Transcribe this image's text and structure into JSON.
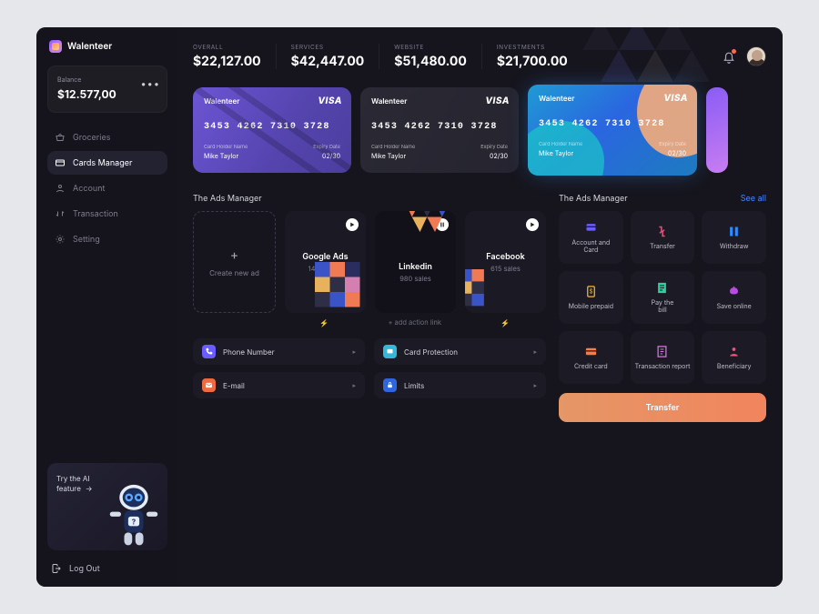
{
  "brand": "Walenteer",
  "balance": {
    "label": "Balance",
    "value": "$12.577,00"
  },
  "nav": {
    "groceries": "Groceries",
    "cards": "Cards Manager",
    "account": "Account",
    "transaction": "Transaction",
    "setting": "Setting"
  },
  "ai": {
    "line1": "Try the AI",
    "line2": "feature"
  },
  "logout": "Log Out",
  "kpi": {
    "overall": {
      "l": "OVERALL",
      "v": "$22,127.00"
    },
    "services": {
      "l": "SERVICES",
      "v": "$42,447.00"
    },
    "website": {
      "l": "WEBSITE",
      "v": "$51,480.00"
    },
    "investments": {
      "l": "INVESTMENTS",
      "v": "$21,700.00"
    }
  },
  "cards": [
    {
      "brand": "Walenteer",
      "network": "VISA",
      "number": "3453 4262 7310 3728",
      "holder_l": "Card Holder Name",
      "holder": "Mike Taylor",
      "exp_l": "Expiry Date",
      "exp": "02/30"
    },
    {
      "brand": "Walenteer",
      "network": "VISA",
      "number": "3453 4262 7310 3728",
      "holder_l": "Card Holder Name",
      "holder": "Mike Taylor",
      "exp_l": "Expiry Date",
      "exp": "02/30"
    },
    {
      "brand": "Walenteer",
      "network": "VISA",
      "number": "3453 4262 7310 3728",
      "holder_l": "Card Holder Name",
      "holder": "Mike Taylor",
      "exp_l": "Expiry Date",
      "exp": "02/30"
    }
  ],
  "sections": {
    "ads": "The Ads Manager",
    "services": "The Ads Manager",
    "see_all": "See all"
  },
  "ads": {
    "new": "Create new ad",
    "google": {
      "title": "Google Ads",
      "sub": "1400 sales"
    },
    "linkedin": {
      "title": "Linkedin",
      "sub": "980 sales"
    },
    "facebook": {
      "title": "Facebook",
      "sub": "615 sales"
    },
    "add_link": "+ add action link"
  },
  "inputs": {
    "phone": "Phone Number",
    "email": "E-mail",
    "card_protection": "Card Protection",
    "limits": "Limits"
  },
  "services": {
    "items": [
      {
        "t": "Account and Card",
        "c": "#6a5cff"
      },
      {
        "t": "Transfer",
        "c": "#e94d7a"
      },
      {
        "t": "Withdraw",
        "c": "#2e8bff"
      },
      {
        "t": "Mobile prepaid",
        "c": "#f3b63c"
      },
      {
        "t": "Pay the bill",
        "c": "#2ed0a0"
      },
      {
        "t": "Save online",
        "c": "#b64de0"
      },
      {
        "t": "Credit card",
        "c": "#ff7a3d"
      },
      {
        "t": "Transaction report",
        "c": "#d17bd9"
      },
      {
        "t": "Beneficiary",
        "c": "#ff4d7a"
      }
    ]
  },
  "transfer_btn": "Transfer"
}
